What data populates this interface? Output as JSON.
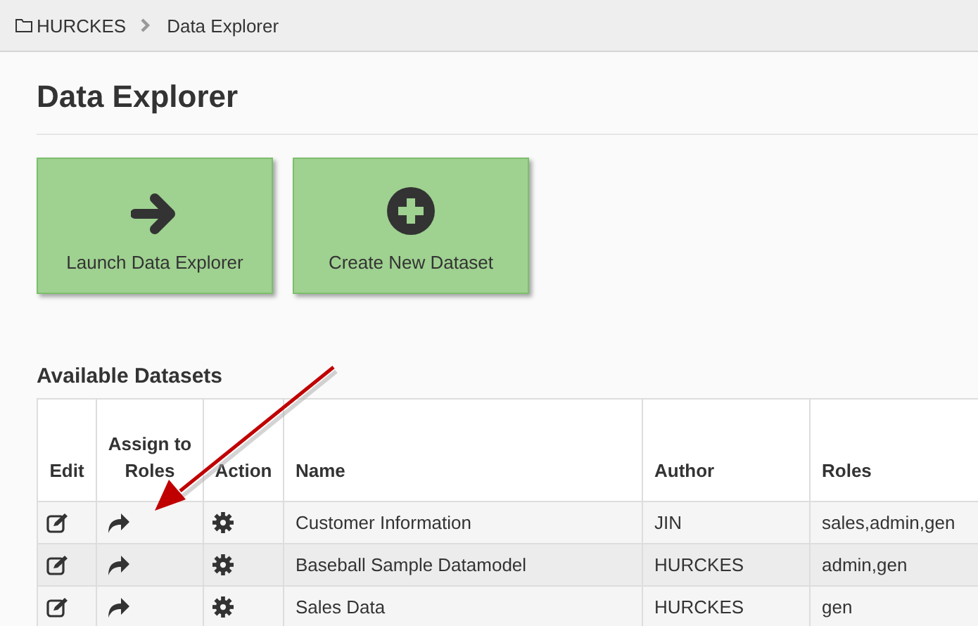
{
  "breadcrumb": [
    {
      "label": "HURCKES",
      "kind": "folder"
    },
    {
      "label": "Data Explorer",
      "kind": "page"
    }
  ],
  "heading": "Data Explorer",
  "action_buttons": [
    {
      "label": "Launch Data Explorer",
      "kind": "arrow"
    },
    {
      "label": "Create New Dataset",
      "kind": "plus"
    }
  ],
  "section_title": "Available Datasets",
  "table": {
    "columns": [
      {
        "label": "Edit",
        "kind": "edit"
      },
      {
        "label": "Assign to Roles",
        "kind": "assign"
      },
      {
        "label": "Action",
        "kind": "action"
      },
      {
        "label": "Name",
        "kind": "text"
      },
      {
        "label": "Author",
        "kind": "text"
      },
      {
        "label": "Roles",
        "kind": "text"
      }
    ],
    "rows": [
      {
        "name": "Customer Information",
        "author": "JIN",
        "roles": "sales,admin,gen"
      },
      {
        "name": "Baseball Sample Datamodel",
        "author": "HURCKES",
        "roles": "admin,gen"
      },
      {
        "name": "Sales Data",
        "author": "HURCKES",
        "roles": "gen"
      }
    ]
  },
  "annotation": {
    "kind": "arrow"
  }
}
